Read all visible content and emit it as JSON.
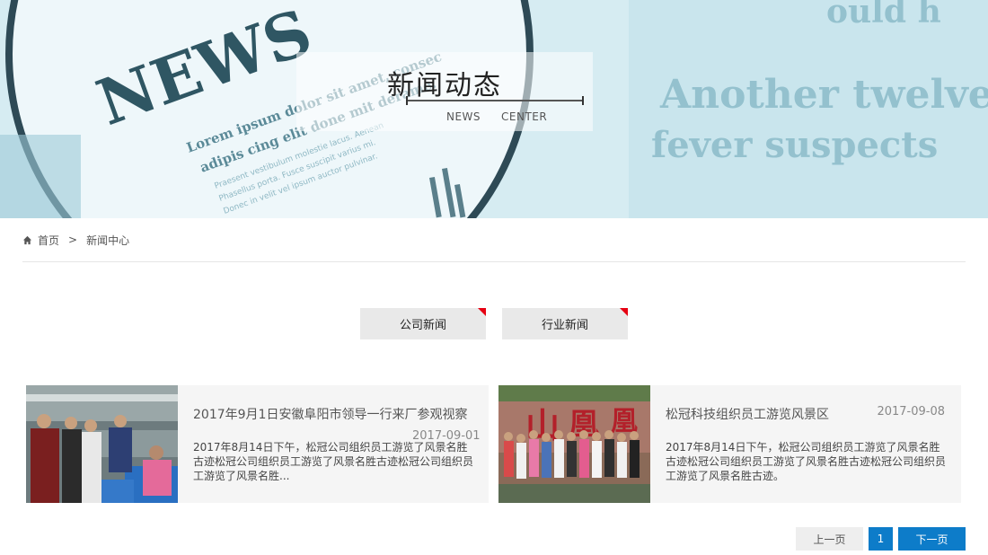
{
  "banner": {
    "title": "新闻动态",
    "sub_left": "NEWS",
    "sub_right": "CENTER"
  },
  "breadcrumb": {
    "home": "首页",
    "separator": ">",
    "current": "新闻中心"
  },
  "tabs": [
    {
      "label": "公司新闻"
    },
    {
      "label": "行业新闻"
    }
  ],
  "news": [
    {
      "title": "2017年9月1日安徽阜阳市领导一行来厂参观视察",
      "date": "2017-09-01",
      "summary": "2017年8月14日下午，松冠公司组织员工游览了风景名胜古迹松冠公司组织员工游览了风景名胜古迹松冠公司组织员工游览了风景名胜..."
    },
    {
      "title": "松冠科技组织员工游览风景区",
      "date": "2017-09-08",
      "summary": "2017年8月14日下午，松冠公司组织员工游览了风景名胜古迹松冠公司组织员工游览了风景名胜古迹松冠公司组织员工游览了风景名胜古迹。"
    }
  ],
  "pagination": {
    "prev": "上一页",
    "current": "1",
    "next": "下一页"
  },
  "colors": {
    "accent_blue": "#0d7cc9",
    "tab_corner_red": "#e60012"
  }
}
